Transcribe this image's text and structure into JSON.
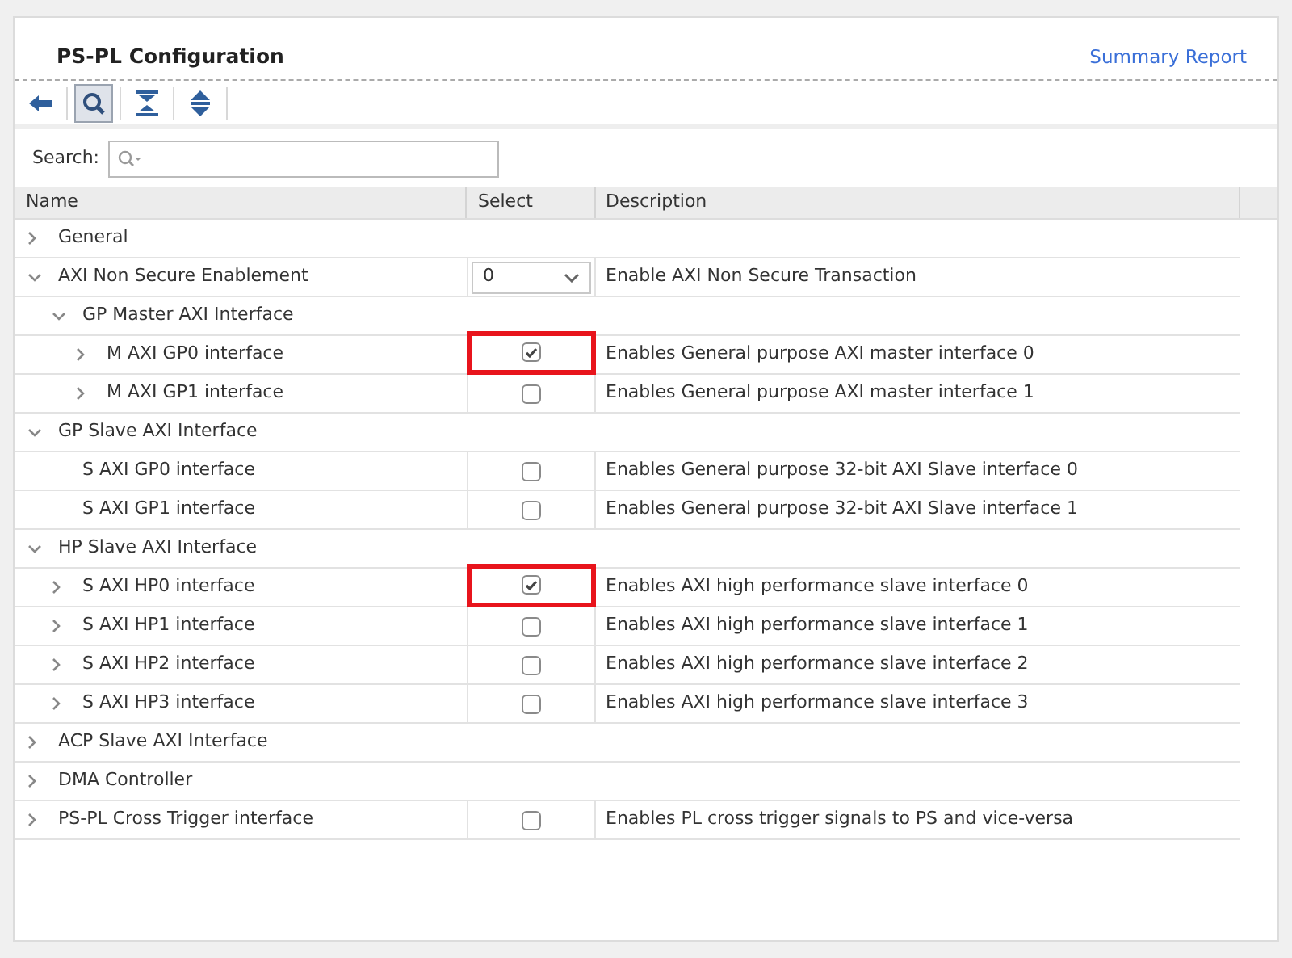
{
  "title": "PS-PL Configuration",
  "summary_link": "Summary Report",
  "toolbar": [
    {
      "kind": "back",
      "selected": false
    },
    {
      "kind": "search",
      "selected": true
    },
    {
      "kind": "collapse",
      "selected": false
    },
    {
      "kind": "expand",
      "selected": false
    }
  ],
  "search": {
    "label": "Search:"
  },
  "table": {
    "columns": [
      "Name",
      "Select",
      "Description"
    ],
    "rows": [
      {
        "name": "General",
        "expanded": false
      },
      {
        "name": "AXI Non Secure Enablement",
        "expanded": true,
        "kind": "dropdown",
        "value": "0",
        "description": "Enable AXI Non Secure Transaction",
        "children": [
          {
            "name": "GP Master AXI Interface",
            "expanded": true,
            "children": [
              {
                "name": "M AXI GP0 interface",
                "expanded": false,
                "kind": "checkbox",
                "checked": true,
                "highlighted": true,
                "description": "Enables General purpose AXI master interface 0"
              },
              {
                "name": "M AXI GP1 interface",
                "expanded": false,
                "kind": "checkbox",
                "checked": false,
                "highlighted": false,
                "description": "Enables General purpose AXI master interface 1"
              }
            ]
          }
        ]
      },
      {
        "name": "GP Slave AXI Interface",
        "expanded": true,
        "children": [
          {
            "name": "S AXI GP0 interface",
            "kind": "checkbox",
            "checked": false,
            "highlighted": false,
            "description": "Enables General purpose 32-bit AXI Slave interface 0"
          },
          {
            "name": "S AXI GP1 interface",
            "kind": "checkbox",
            "checked": false,
            "highlighted": false,
            "description": "Enables General purpose 32-bit AXI Slave interface 1"
          }
        ]
      },
      {
        "name": "HP Slave AXI Interface",
        "expanded": true,
        "children": [
          {
            "name": "S AXI HP0 interface",
            "expanded": false,
            "kind": "checkbox",
            "checked": true,
            "highlighted": true,
            "description": "Enables AXI high performance slave interface 0"
          },
          {
            "name": "S AXI HP1 interface",
            "expanded": false,
            "kind": "checkbox",
            "checked": false,
            "highlighted": false,
            "description": "Enables AXI high performance slave interface 1"
          },
          {
            "name": "S AXI HP2 interface",
            "expanded": false,
            "kind": "checkbox",
            "checked": false,
            "highlighted": false,
            "description": "Enables AXI high performance slave interface 2"
          },
          {
            "name": "S AXI HP3 interface",
            "expanded": false,
            "kind": "checkbox",
            "checked": false,
            "highlighted": false,
            "description": "Enables AXI high performance slave interface 3"
          }
        ]
      },
      {
        "name": "ACP Slave AXI Interface",
        "expanded": false
      },
      {
        "name": "DMA Controller",
        "expanded": false
      },
      {
        "name": "PS-PL Cross Trigger interface",
        "expanded": false,
        "kind": "checkbox",
        "checked": false,
        "highlighted": false,
        "description": "Enables PL cross trigger signals to PS and vice-versa"
      }
    ]
  }
}
